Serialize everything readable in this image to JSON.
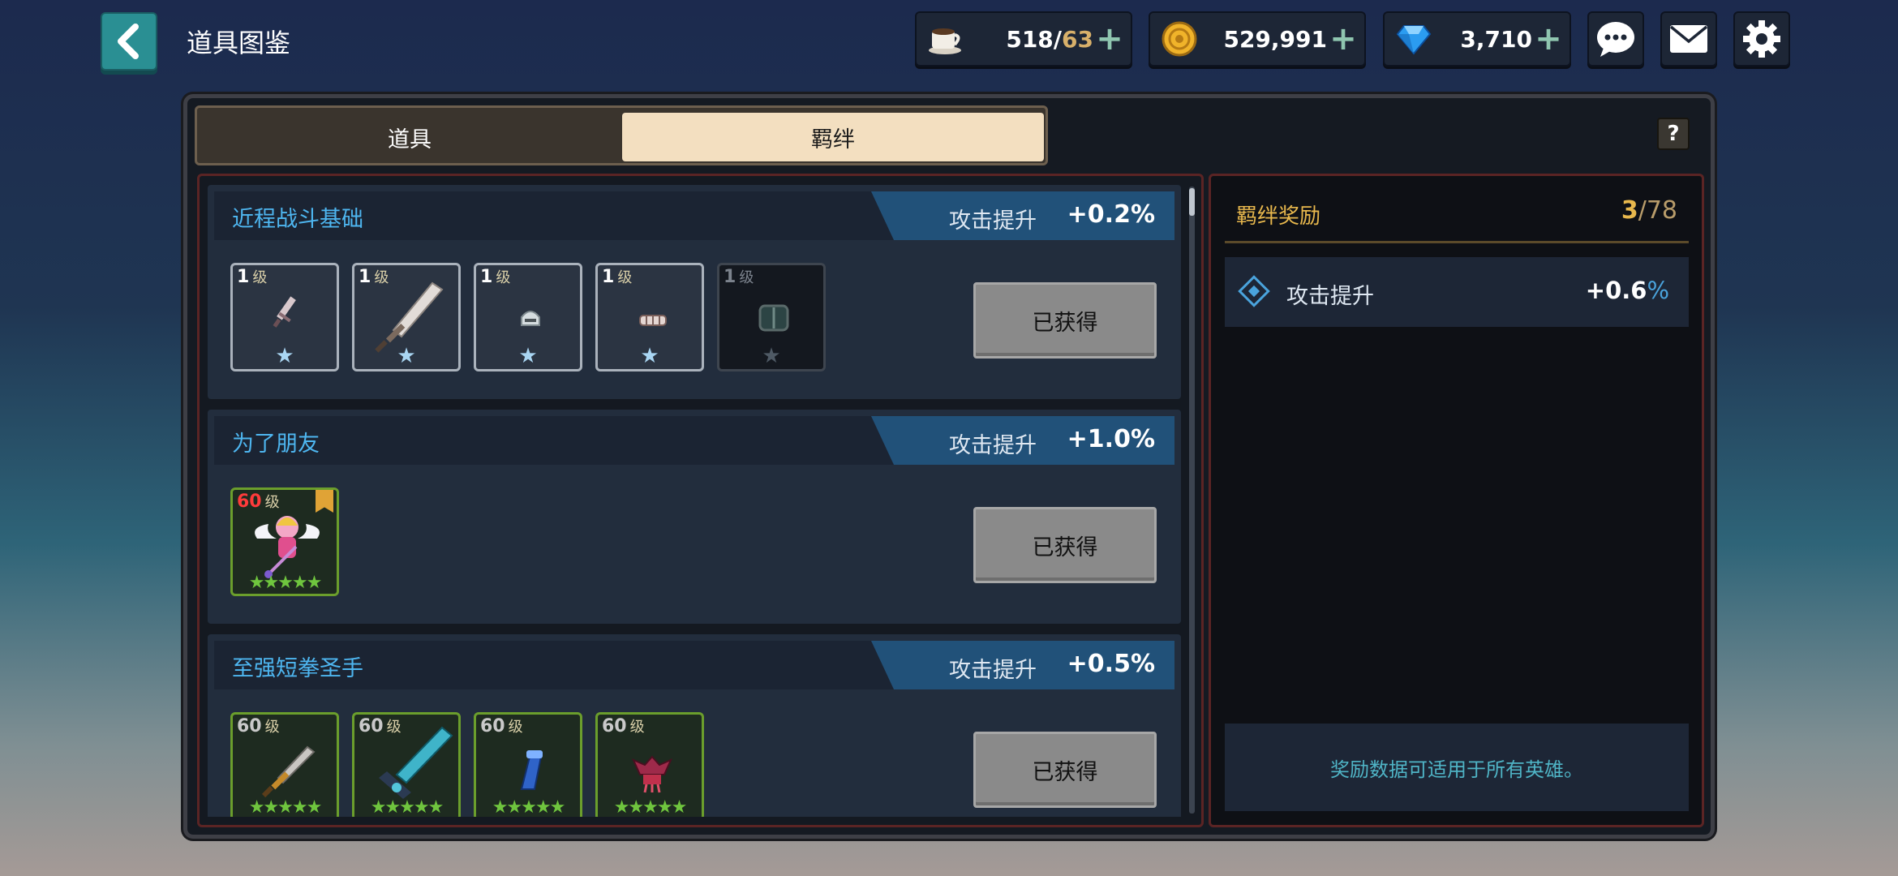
{
  "header": {
    "title": "道具图鉴"
  },
  "resources": [
    {
      "name": "stamina",
      "icon": "coffee-cup-icon",
      "value_main": "518/",
      "value_sub": "63"
    },
    {
      "name": "gold",
      "icon": "gold-coin-icon",
      "value_main": "529,991",
      "value_sub": ""
    },
    {
      "name": "gems",
      "icon": "blue-gem-icon",
      "value_main": "3,710",
      "value_sub": ""
    }
  ],
  "tabs": [
    {
      "label": "道具",
      "active": false
    },
    {
      "label": "羁绊",
      "active": true
    }
  ],
  "help_label": "?",
  "bond_sets": [
    {
      "title": "近程战斗基础",
      "bonus_label": "攻击提升",
      "bonus_value": "+0.2%",
      "button_label": "已获得",
      "items": [
        {
          "level": "1",
          "unit": "级",
          "icon": "short-sword-icon",
          "dim": false
        },
        {
          "level": "1",
          "unit": "级",
          "icon": "broad-sword-icon",
          "dim": false
        },
        {
          "level": "1",
          "unit": "级",
          "icon": "helmet-icon",
          "dim": false
        },
        {
          "level": "1",
          "unit": "级",
          "icon": "gauntlet-icon",
          "dim": false
        },
        {
          "level": "1",
          "unit": "级",
          "icon": "shield-icon",
          "dim": true
        }
      ]
    },
    {
      "title": "为了朋友",
      "bonus_label": "攻击提升",
      "bonus_value": "+1.0%",
      "button_label": "已获得",
      "items": [
        {
          "level": "60",
          "unit": "级",
          "icon": "winged-hero-icon",
          "stars": "★★★★★"
        }
      ]
    },
    {
      "title": "至强短拳圣手",
      "bonus_label": "攻击提升",
      "bonus_value": "+0.5%",
      "button_label": "已获得",
      "items": [
        {
          "level": "60",
          "unit": "级",
          "icon": "golden-sword-icon",
          "stars": "★★★★★"
        },
        {
          "level": "60",
          "unit": "级",
          "icon": "crystal-greatsword-icon",
          "stars": "★★★★★"
        },
        {
          "level": "60",
          "unit": "级",
          "icon": "blue-gauntlet-icon",
          "stars": "★★★★★"
        },
        {
          "level": "60",
          "unit": "级",
          "icon": "demon-claw-icon",
          "stars": "★★★★★"
        }
      ]
    }
  ],
  "reward_panel": {
    "title": "羁绊奖励",
    "count_current": "3",
    "count_total": "/78",
    "stat_label": "攻击提升",
    "stat_value": "+0.6",
    "stat_unit": "%",
    "note": "奖励数据可适用于所有英雄。"
  },
  "colors": {
    "accent_blue": "#4eb6f0",
    "gold": "#e8b84d",
    "tab_active": "#f3dfc0",
    "back_button": "#2a8f93"
  }
}
